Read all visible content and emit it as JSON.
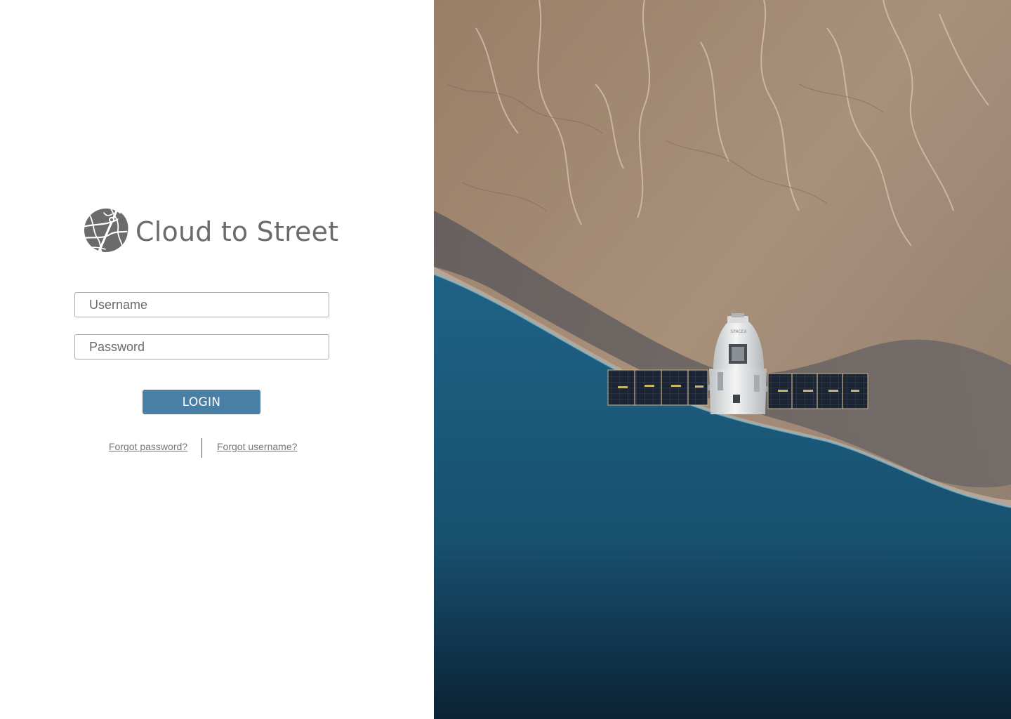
{
  "brand": {
    "name": "Cloud to Street",
    "logo_icon": "globe-leaf-icon"
  },
  "login": {
    "username_placeholder": "Username",
    "password_placeholder": "Password",
    "button_label": "LOGIN",
    "forgot_password": "Forgot password?",
    "forgot_username": "Forgot username?"
  },
  "hero": {
    "subject": "satellite-over-coastline-image",
    "capsule_label": "SPACEX"
  },
  "colors": {
    "accent": "#4a7fa5",
    "logo_gray": "#6b6b6b",
    "link_gray": "#777777",
    "ocean": "#1d5a7e",
    "land": "#a48a72"
  }
}
